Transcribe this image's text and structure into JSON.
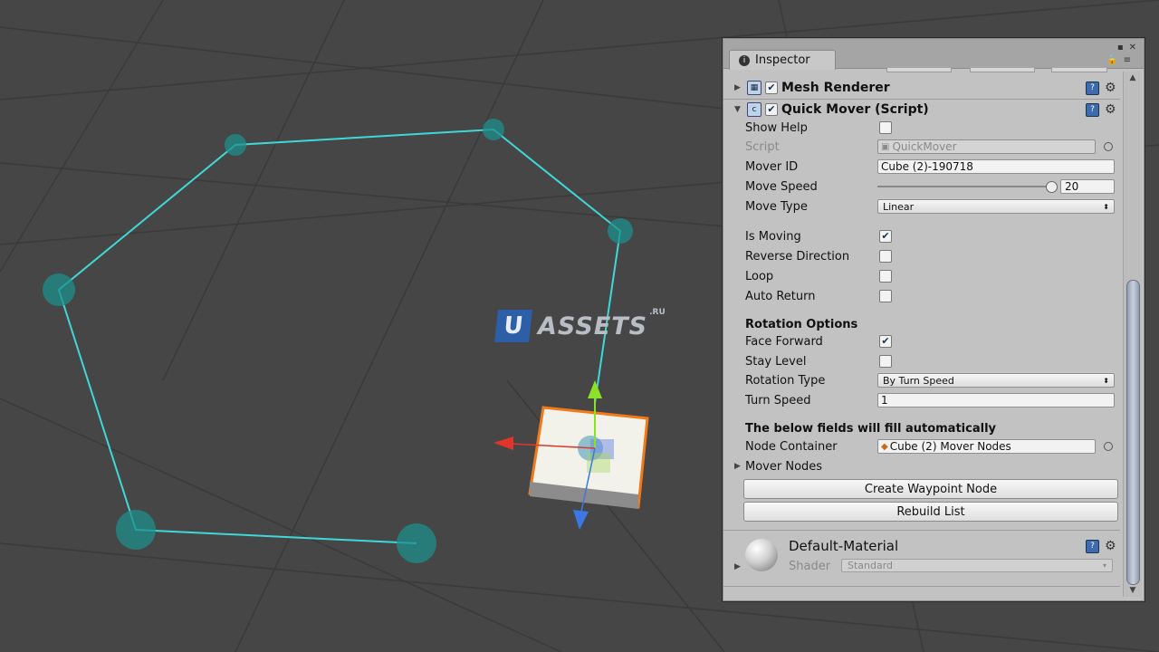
{
  "watermark": {
    "u": "U",
    "text": "ASSETS",
    "suffix": ".RU"
  },
  "inspector": {
    "tab_label": "Inspector",
    "mesh_renderer": {
      "title": "Mesh Renderer",
      "enabled": true
    },
    "quick_mover": {
      "title": "Quick Mover (Script)",
      "enabled": true,
      "show_help": {
        "label": "Show Help",
        "checked": false
      },
      "script": {
        "label": "Script",
        "value": "QuickMover"
      },
      "mover_id": {
        "label": "Mover ID",
        "value": "Cube (2)-190718"
      },
      "move_speed": {
        "label": "Move Speed",
        "value": "20",
        "slider_fraction": 0.98
      },
      "move_type": {
        "label": "Move Type",
        "value": "Linear"
      },
      "is_moving": {
        "label": "Is Moving",
        "checked": true
      },
      "reverse_direction": {
        "label": "Reverse Direction",
        "checked": false
      },
      "loop": {
        "label": "Loop",
        "checked": false
      },
      "auto_return": {
        "label": "Auto Return",
        "checked": false
      },
      "rotation_header": "Rotation Options",
      "face_forward": {
        "label": "Face Forward",
        "checked": true
      },
      "stay_level": {
        "label": "Stay Level",
        "checked": false
      },
      "rotation_type": {
        "label": "Rotation Type",
        "value": "By Turn Speed"
      },
      "turn_speed": {
        "label": "Turn Speed",
        "value": "1"
      },
      "auto_header": "The below fields will fill automatically",
      "node_container": {
        "label": "Node Container",
        "value": "Cube (2) Mover Nodes"
      },
      "mover_nodes": {
        "label": "Mover Nodes"
      },
      "create_button": "Create Waypoint Node",
      "rebuild_button": "Rebuild List"
    },
    "material": {
      "name": "Default-Material",
      "shader_label": "Shader",
      "shader_value": "Standard"
    }
  },
  "colors": {
    "background": "#464646",
    "path": "#3fd8d8",
    "waypoint": "#1e8f8c",
    "cube_outline": "#f07a1a"
  }
}
